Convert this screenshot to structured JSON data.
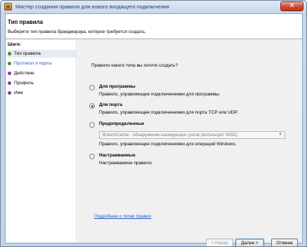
{
  "window": {
    "title": "Мастер создания правила для нового входящего подключения",
    "close_glyph": "✕"
  },
  "header": {
    "title": "Тип правила",
    "subtitle": "Выберите тип правила брандмауэра, которое требуется создать."
  },
  "steps": {
    "title": "Шаги:",
    "items": [
      {
        "label": "Тип правила",
        "state": "current"
      },
      {
        "label": "Протокол и порты",
        "state": "done-link"
      },
      {
        "label": "Действие",
        "state": "todo"
      },
      {
        "label": "Профиль",
        "state": "todo"
      },
      {
        "label": "Имя",
        "state": "todo"
      }
    ]
  },
  "main": {
    "question": "Правило какого типа вы хотите создать?",
    "options": [
      {
        "label": "Для программы",
        "description": "Правило, управляющее подключениями для программы.",
        "selected": false
      },
      {
        "label": "Для порта",
        "description": "Правило, управляющее подключениями для порта TCP или UDP.",
        "selected": true
      },
      {
        "label": "Предопределенные",
        "description": "Правило, управляющее подключениями для операций Windows.",
        "selected": false,
        "dropdown_value": "BranchCache - обнаружение кэширующих узлов (использует WSD)"
      },
      {
        "label": "Настраиваемые",
        "description": "Настраиваемое правило.",
        "selected": false
      }
    ],
    "help_link": "Подробнее о типах правил"
  },
  "buttons": {
    "back": "< Назад",
    "next": "Далее >",
    "cancel": "Отмена"
  },
  "colors": {
    "accent_link": "#1b5ac4",
    "step_current": "#3a8f2a",
    "step_todo": "#7b3fa6"
  }
}
